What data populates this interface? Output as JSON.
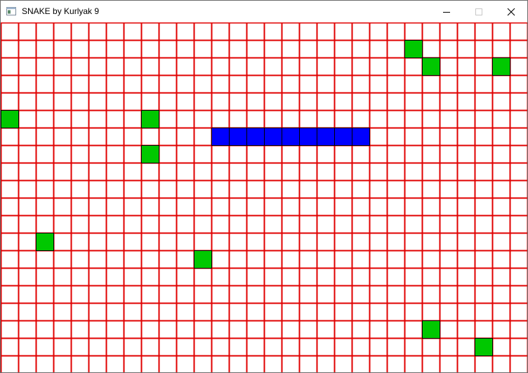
{
  "window": {
    "title": "SNAKE by Kurlyak 9",
    "icon": "window-app-icon",
    "controls": [
      "minimize-icon",
      "maximize-icon",
      "close-icon"
    ]
  },
  "board": {
    "columns": 30,
    "rows": 20,
    "grid_color": "#e00000",
    "background_color": "#ffffff",
    "food_color": "#00c800",
    "snake_color": "#0000ff",
    "outline_color": "#000000",
    "snake": [
      [
        12,
        6
      ],
      [
        13,
        6
      ],
      [
        14,
        6
      ],
      [
        15,
        6
      ],
      [
        16,
        6
      ],
      [
        17,
        6
      ],
      [
        18,
        6
      ],
      [
        19,
        6
      ],
      [
        20,
        6
      ]
    ],
    "food": [
      [
        23,
        1
      ],
      [
        24,
        2
      ],
      [
        28,
        2
      ],
      [
        0,
        5
      ],
      [
        8,
        5
      ],
      [
        8,
        7
      ],
      [
        2,
        12
      ],
      [
        11,
        13
      ],
      [
        24,
        17
      ],
      [
        27,
        18
      ]
    ]
  }
}
